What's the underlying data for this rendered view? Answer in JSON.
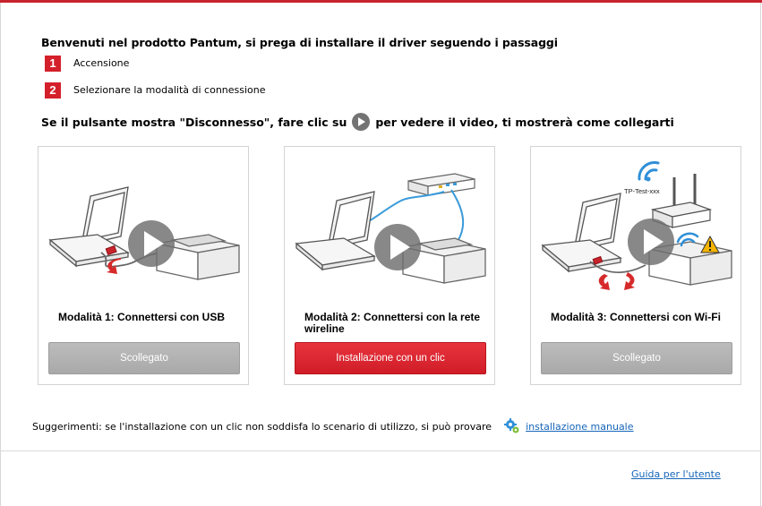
{
  "header": {
    "welcome": "Benvenuti nel prodotto Pantum, si prega di installare il driver seguendo i passaggi",
    "steps": [
      {
        "number": "1",
        "label": "Accensione"
      },
      {
        "number": "2",
        "label": "Selezionare la modalità di connessione"
      }
    ],
    "hint_before": "Se il pulsante mostra \"Disconnesso\", fare clic su",
    "hint_after": "per vedere il video, ti mostrerà come collegarti"
  },
  "cards": [
    {
      "title": "Modalità 1: Connettersi con USB",
      "button": "Scollegato"
    },
    {
      "title": "Modalità 2: Connettersi con la rete wireline",
      "button": "Installazione con un clic"
    },
    {
      "title": "Modalità 3: Connettersi con Wi-Fi",
      "button": "Scollegato",
      "ssid": "TP-Test-xxx"
    }
  ],
  "footer": {
    "suggestion": "Suggerimenti: se l'installazione con un clic non soddisfa lo scenario di utilizzo, si può provare",
    "manual_link": "installazione manuale",
    "guide_link": "Guida per l'utente"
  },
  "colors": {
    "accent": "#d4202a",
    "link": "#1565b8",
    "disabled_button": "#b0b0b0"
  }
}
